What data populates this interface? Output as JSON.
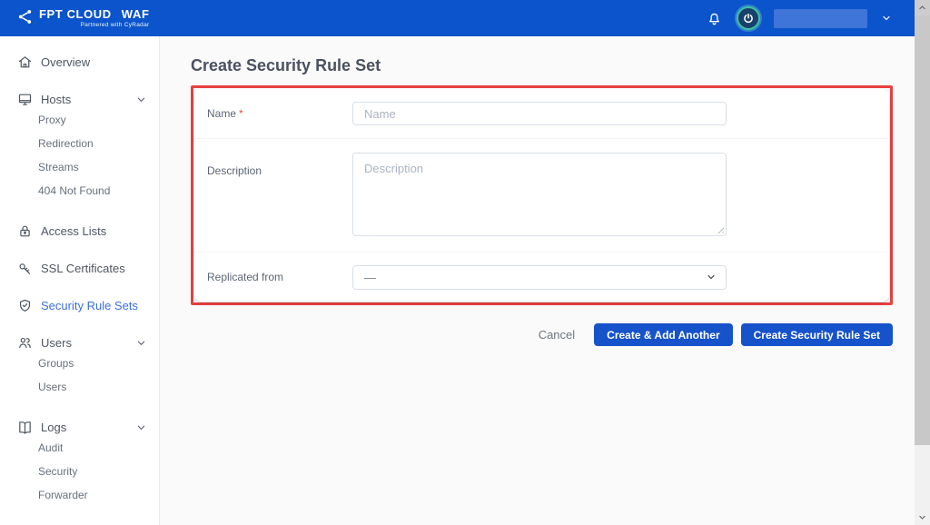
{
  "header": {
    "brand": "FPT CLOUD",
    "product": "WAF",
    "tagline": "Partnered with CyRadar"
  },
  "sidebar": {
    "items": [
      {
        "label": "Overview",
        "icon": "home"
      },
      {
        "label": "Hosts",
        "icon": "monitor",
        "expanded": true,
        "children": [
          {
            "label": "Proxy"
          },
          {
            "label": "Redirection"
          },
          {
            "label": "Streams"
          },
          {
            "label": "404 Not Found"
          }
        ]
      },
      {
        "label": "Access Lists",
        "icon": "lock"
      },
      {
        "label": "SSL Certificates",
        "icon": "key"
      },
      {
        "label": "Security Rule Sets",
        "icon": "shield-check",
        "active": true
      },
      {
        "label": "Users",
        "icon": "users",
        "expanded": true,
        "children": [
          {
            "label": "Groups"
          },
          {
            "label": "Users"
          }
        ]
      },
      {
        "label": "Logs",
        "icon": "book",
        "expanded": true,
        "children": [
          {
            "label": "Audit"
          },
          {
            "label": "Security"
          },
          {
            "label": "Forwarder"
          }
        ]
      }
    ]
  },
  "main": {
    "title": "Create Security Rule Set",
    "form": {
      "required_marker": "*",
      "fields": {
        "name": {
          "label": "Name",
          "placeholder": "Name",
          "value": ""
        },
        "description": {
          "label": "Description",
          "placeholder": "Description",
          "value": ""
        },
        "replicated_from": {
          "label": "Replicated from",
          "value": "—"
        }
      }
    },
    "actions": {
      "cancel": "Cancel",
      "create_add_another": "Create & Add Another",
      "create": "Create Security Rule Set"
    }
  },
  "colors": {
    "header_blue": "#0b54cb",
    "button_blue": "#1652c9",
    "active_link_blue": "#3b6fe0",
    "annotation_red": "#e94040"
  }
}
